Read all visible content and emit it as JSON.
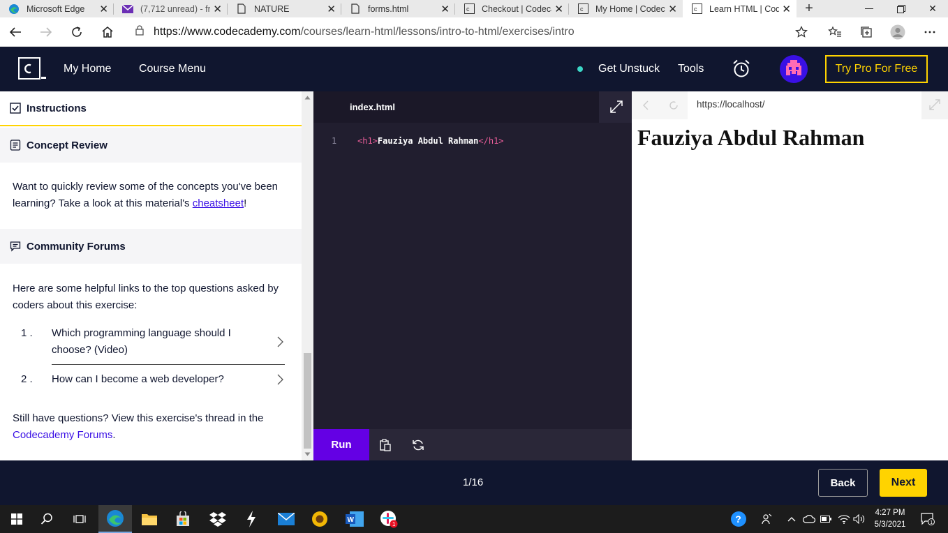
{
  "browser": {
    "tabs": [
      {
        "label": "Microsoft Edge",
        "icon": "edge-icon"
      },
      {
        "label": "(7,712 unread) - fr",
        "icon": "mail-icon"
      },
      {
        "label": "NATURE",
        "icon": "page-icon"
      },
      {
        "label": "forms.html",
        "icon": "page-icon"
      },
      {
        "label": "Checkout | Codeca",
        "icon": "codecademy-icon"
      },
      {
        "label": "My Home | Codeca",
        "icon": "codecademy-icon"
      },
      {
        "label": "Learn HTML | Cod",
        "icon": "codecademy-icon",
        "active": true
      }
    ],
    "url_host": "https://www.codecademy.com",
    "url_path": "/courses/learn-html/lessons/intro-to-html/exercises/intro"
  },
  "header": {
    "my_home": "My Home",
    "course_menu": "Course Menu",
    "get_unstuck": "Get Unstuck",
    "tools": "Tools",
    "try_pro": "Try Pro For Free"
  },
  "instructions": {
    "instructions_title": "Instructions",
    "concept_title": "Concept Review",
    "concept_text_before": "Want to quickly review some of the concepts you've been learning? Take a look at this material's ",
    "concept_link": "cheatsheet",
    "concept_text_after": "!",
    "forums_title": "Community Forums",
    "forums_intro": "Here are some helpful links to the top questions asked by coders about this exercise:",
    "questions": [
      {
        "num": "1 .",
        "text": "Which programming language should I choose? (Video)"
      },
      {
        "num": "2 .",
        "text": "How can I become a web developer?"
      }
    ],
    "still_text": "Still have questions? View this exercise's thread in the ",
    "forums_link": "Codecademy Forums",
    "still_end": "."
  },
  "editor": {
    "filename": "index.html",
    "line_number": "1",
    "open_tag": "<h1>",
    "content": "Fauziya Abdul Rahman",
    "close_tag": "</h1>",
    "run_label": "Run"
  },
  "preview": {
    "url": "https://localhost/",
    "heading": "Fauziya Abdul Rahman"
  },
  "footer": {
    "progress": "1/16",
    "back_label": "Back",
    "next_label": "Next"
  },
  "taskbar": {
    "time": "4:27 PM",
    "date": "5/3/2021"
  },
  "colors": {
    "navy": "#10162f",
    "accent_yellow": "#ffd300",
    "run_purple": "#6400e4",
    "link_purple": "#3a10e5",
    "tag_pink": "#e85d98"
  }
}
